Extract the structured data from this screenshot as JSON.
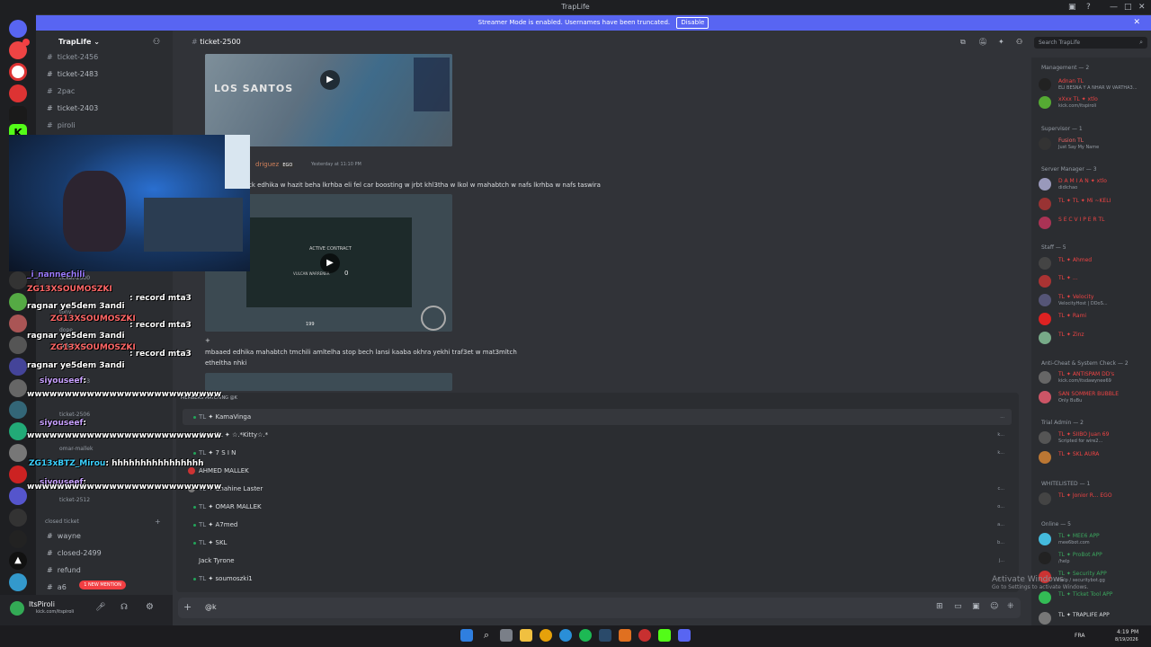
{
  "window": {
    "title": "TrapLife"
  },
  "banner": {
    "text": "Streamer Mode is enabled. Usernames have been truncated.",
    "button": "Disable"
  },
  "guild": {
    "name": "TrapLife",
    "accent": "#5865f2"
  },
  "channels": {
    "items": [
      "ticket-2456",
      "ticket-2483",
      "2pac",
      "ticket-2403",
      "piroli"
    ],
    "overlay_items": [
      "ticket-2500",
      "tony",
      "dope",
      "ticket-2500",
      "ticket-2503",
      "ticket-2506",
      "omar-mallek",
      "ticket-2512"
    ],
    "category": "closed ticket",
    "closed": [
      "wayne",
      "closed-2499",
      "refund",
      "a6"
    ],
    "new_mention": "1 NEW MENTION"
  },
  "user": {
    "name": "ItsPiroli",
    "status": "kick.com/itspiroli"
  },
  "chat": {
    "channel": "ticket-2500",
    "search_placeholder": "Search TrapLife",
    "video1_label": "LOS SANTOS",
    "author_partial": "driguez",
    "author_tag": "EGO",
    "timestamp": "Yesterday at 11:10 PM",
    "msg1": "ck edhika w hazit beha lkrhba eli fel car boosting w jrbt khl3tha w lkol w mahabtch  w nafs lkrhba w nafs taswira",
    "contract_title": "ACTIVE CONTRACT",
    "contract_car": "VULCAN WARRENER",
    "contract_count": "0",
    "contract_speed": "199",
    "plus": "+",
    "msg2a": "mbaaed edhika mahabtch tmchili amltelha stop bech lansi kaaba okhra yekhi traf3et w mat3mltch",
    "msg2b": "etheltha nhki",
    "input_value": "@k"
  },
  "popup": {
    "title": "MEMBERS MATCHING @K",
    "members": [
      {
        "tag": "TL",
        "name": "KamaVinga",
        "right": "..."
      },
      {
        "tag": "TL",
        "name": "TL  ✦  ☆.*Kitty☆.*",
        "right": "k..."
      },
      {
        "tag": "TL",
        "name": "7 S I N",
        "right": "k..."
      },
      {
        "tag": "",
        "name": "AHMED MALLEK",
        "right": ""
      },
      {
        "tag": "TL",
        "name": "Chahine Laster",
        "right": "c..."
      },
      {
        "tag": "TL",
        "name": "OMAR MALLEK",
        "right": "o..."
      },
      {
        "tag": "TL",
        "name": "A7med",
        "right": "a..."
      },
      {
        "tag": "TL",
        "name": "SKL",
        "right": "b..."
      },
      {
        "tag": "",
        "name": "Jack Tyrone",
        "right": "j..."
      },
      {
        "tag": "TL",
        "name": "soumoszki1",
        "right": "s..."
      }
    ]
  },
  "members": {
    "categories": [
      {
        "label": "Management — 2"
      },
      {
        "label": "Supervisor — 1"
      },
      {
        "label": "Server Manager — 3"
      },
      {
        "label": "Staff — 5"
      },
      {
        "label": "Anti-Cheat & System Check — 2"
      },
      {
        "label": "Trial Admin — 2"
      },
      {
        "label": "WHITELISTED — 1"
      },
      {
        "label": "Online — 5"
      }
    ],
    "list": [
      {
        "name": "Adnan  TL",
        "sub": "ELI BESNA Y A NHAR W VARTHA3..."
      },
      {
        "name": "xXxx  TL  ✦ xtlo",
        "sub": "kick.com/itspiroli"
      },
      {
        "name": "Fusion  TL",
        "sub": "Just Say My Name"
      },
      {
        "name": "D A M I A N  ✦ xtlo",
        "sub": "didichao"
      },
      {
        "name": "TL  ✦  TL  ✦  Mi  ~KELI",
        "sub": ""
      },
      {
        "name": "S E C  V I P E R  TL",
        "sub": ""
      },
      {
        "name": "TL  ✦  Ahmed",
        "sub": ""
      },
      {
        "name": "TL  ✦  ...",
        "sub": ""
      },
      {
        "name": "TL  ✦  Velocity",
        "sub": "VelocityHost | DDoS..."
      },
      {
        "name": "TL  ✦  Rami",
        "sub": ""
      },
      {
        "name": "TL  ✦  Zinz",
        "sub": ""
      },
      {
        "name": "TL  ✦  ANTISPAM  DD's",
        "sub": "kick.com/itsdawynee69"
      },
      {
        "name": "SAN SOMMER  BUBBLE",
        "sub": "Only BuBu"
      },
      {
        "name": "TL  ✦  SIIBO Juan  69",
        "sub": "Scripted for wire2..."
      },
      {
        "name": "TL  ✦  SKL  AURA",
        "sub": ""
      },
      {
        "name": "TL  ✦  Jonior R...  EGO",
        "sub": ""
      },
      {
        "name": "TL  ✦  MEE6  APP",
        "sub": "mee6bot.com"
      },
      {
        "name": "TL  ✦  ProBot  APP",
        "sub": "/help"
      },
      {
        "name": "TL  ✦  Security  APP",
        "sub": "help / securitybot.gg"
      },
      {
        "name": "TL  ✦  Ticket Tool  APP",
        "sub": ""
      },
      {
        "name": "TL  ✦  TRAPLIFE  APP",
        "sub": ""
      }
    ]
  },
  "stream_chat": [
    {
      "user": "_i_nannechili",
      "msg": ""
    },
    {
      "user": "ZG13XSOUMOSZKI",
      "msg": ": record mta3"
    },
    {
      "user": "ragnar ye5dem 3andi",
      "msg": ""
    },
    {
      "user": "ZG13XSOUMOSZKI",
      "msg": ": record mta3"
    },
    {
      "user": "ragnar ye5dem 3andi",
      "msg": ""
    },
    {
      "user": "ZG13XSOUMOSZKI",
      "msg": ": record mta3"
    },
    {
      "user": "ragnar ye5dem 3andi",
      "msg": ""
    },
    {
      "user": "siyouseef",
      "msg": ":"
    },
    {
      "user": "",
      "msg": "wwwwwwwwwwwwwwwwwwwwwwwwww"
    },
    {
      "user": "siyouseef",
      "msg": ":"
    },
    {
      "user": "",
      "msg": "wwwwwwwwwwwwwwwwwwwwwwwwww"
    },
    {
      "user": "ZG13xBTZ_Mirou",
      "msg": ": hhhhhhhhhhhhhhhh"
    },
    {
      "user": "siyouseef",
      "msg": ":"
    },
    {
      "user": "",
      "msg": "wwwwwwwwwwwwwwwwwwwwwwwwww"
    }
  ],
  "watermark": {
    "line1": "Activate Windows",
    "line2": "Go to Settings to activate Windows."
  },
  "tray": {
    "lang": "FRA",
    "time": "4:19 PM",
    "date": "8/19/2026"
  }
}
